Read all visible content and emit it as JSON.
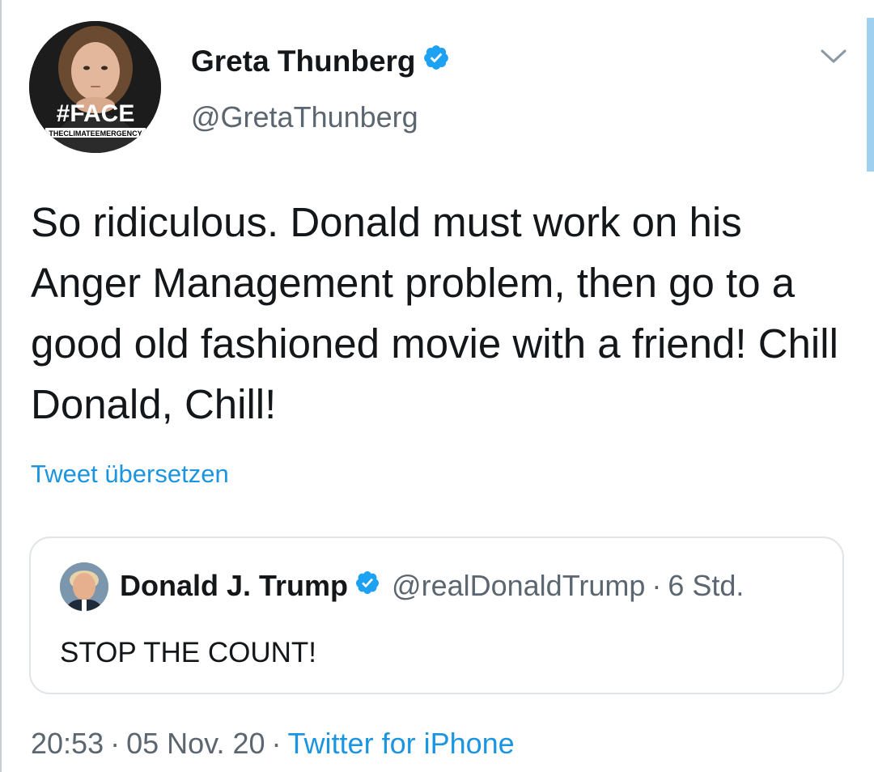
{
  "author": {
    "display_name": "Greta Thunberg",
    "handle": "@GretaThunberg",
    "avatar": {
      "icon": "profile-photo-icon",
      "badge_text": "#FACE",
      "badge_subtext": "THECLIMATEEMERGENCY"
    },
    "verified_icon": "verified-badge-icon"
  },
  "menu_icon": "chevron-down-icon",
  "tweet": {
    "text": "So ridiculous. Donald must work on his Anger Management problem, then go to a good old fashioned movie with a friend! Chill Donald, Chill!"
  },
  "translate_label": "Tweet übersetzen",
  "quoted_tweet": {
    "display_name": "Donald J. Trump",
    "handle": "@realDonaldTrump",
    "separator": "·",
    "time_ago": "6 Std.",
    "text": "STOP THE COUNT!",
    "avatar_icon": "profile-photo-icon",
    "verified_icon": "verified-badge-icon"
  },
  "meta": {
    "time": "20:53",
    "separator": "·",
    "date": "05 Nov. 20",
    "source": "Twitter for iPhone"
  },
  "colors": {
    "link": "#1b95e0",
    "secondary_text": "#5b6670",
    "primary_text": "#14171a",
    "verified": "#1da1f2",
    "card_border": "#dfe4e8"
  }
}
